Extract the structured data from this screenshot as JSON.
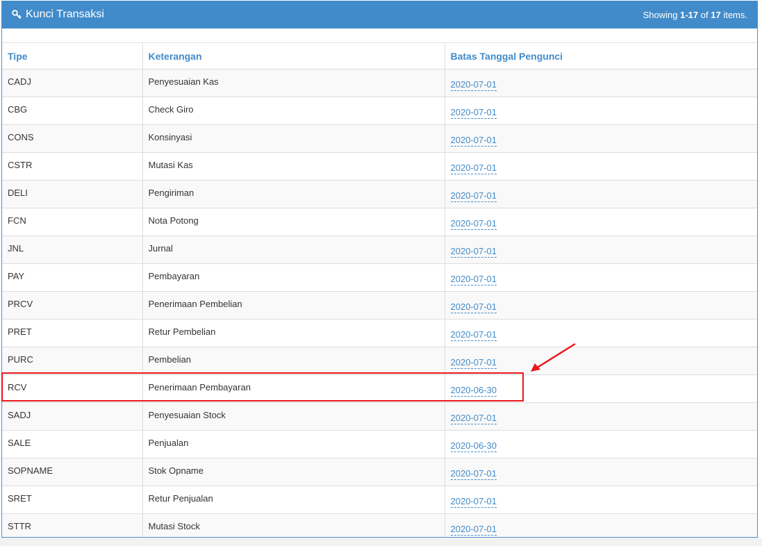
{
  "panel": {
    "title": "Kunci Transaksi",
    "summary_prefix": "Showing ",
    "summary_range": "1-17",
    "summary_of": " of ",
    "summary_total": "17",
    "summary_suffix": " items."
  },
  "table": {
    "headers": {
      "tipe": "Tipe",
      "keterangan": "Keterangan",
      "batas": "Batas Tanggal Pengunci"
    },
    "rows": [
      {
        "tipe": "CADJ",
        "keterangan": "Penyesuaian Kas",
        "batas": "2020-07-01"
      },
      {
        "tipe": "CBG",
        "keterangan": "Check Giro",
        "batas": "2020-07-01"
      },
      {
        "tipe": "CONS",
        "keterangan": "Konsinyasi",
        "batas": "2020-07-01"
      },
      {
        "tipe": "CSTR",
        "keterangan": "Mutasi Kas",
        "batas": "2020-07-01"
      },
      {
        "tipe": "DELI",
        "keterangan": "Pengiriman",
        "batas": "2020-07-01"
      },
      {
        "tipe": "FCN",
        "keterangan": "Nota Potong",
        "batas": "2020-07-01"
      },
      {
        "tipe": "JNL",
        "keterangan": "Jurnal",
        "batas": "2020-07-01"
      },
      {
        "tipe": "PAY",
        "keterangan": "Pembayaran",
        "batas": "2020-07-01"
      },
      {
        "tipe": "PRCV",
        "keterangan": "Penerimaan Pembelian",
        "batas": "2020-07-01"
      },
      {
        "tipe": "PRET",
        "keterangan": "Retur Pembelian",
        "batas": "2020-07-01"
      },
      {
        "tipe": "PURC",
        "keterangan": "Pembelian",
        "batas": "2020-07-01"
      },
      {
        "tipe": "RCV",
        "keterangan": "Penerimaan Pembayaran",
        "batas": "2020-06-30"
      },
      {
        "tipe": "SADJ",
        "keterangan": "Penyesuaian Stock",
        "batas": "2020-07-01"
      },
      {
        "tipe": "SALE",
        "keterangan": "Penjualan",
        "batas": "2020-06-30"
      },
      {
        "tipe": "SOPNAME",
        "keterangan": "Stok Opname",
        "batas": "2020-07-01"
      },
      {
        "tipe": "SRET",
        "keterangan": "Retur Penjualan",
        "batas": "2020-07-01"
      },
      {
        "tipe": "STTR",
        "keterangan": "Mutasi Stock",
        "batas": "2020-07-01"
      }
    ]
  },
  "annotation": {
    "highlight_color": "#e8181b",
    "icon": "key-icon"
  },
  "colors": {
    "header_bg": "#428bca",
    "link": "#428bca"
  }
}
